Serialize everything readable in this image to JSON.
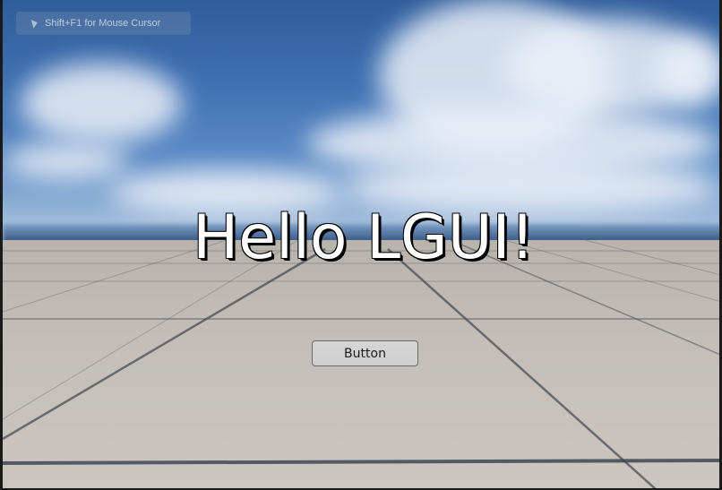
{
  "hint": {
    "text": "Shift+F1 for Mouse Cursor",
    "icon": "mouse-pointer-icon"
  },
  "title": "Hello LGUI!",
  "button": {
    "label": "Button"
  },
  "colors": {
    "sky": "#3f71b3",
    "ground": "#c3beb8",
    "grid_line": "#4a4f5c",
    "title_text": "#ffffff",
    "button_bg": "#d2d2d2"
  }
}
